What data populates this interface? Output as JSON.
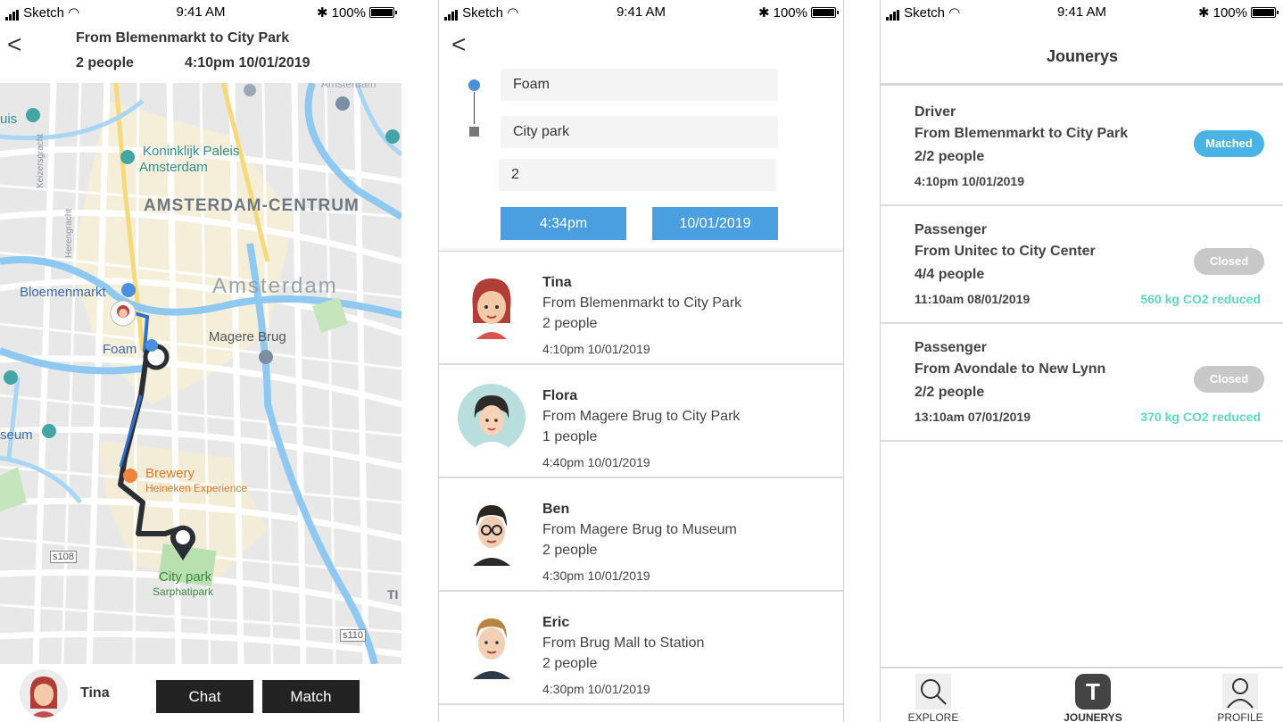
{
  "status": {
    "carrier": "Sketch",
    "time": "9:41 AM",
    "battery": "100%"
  },
  "screen1": {
    "back_label": "<",
    "title": "From Blemenmarkt to City Park",
    "people": "2 people",
    "datetime": "4:10pm 10/01/2019",
    "map_labels": {
      "koninklijk": "Koninklijk Paleis",
      "amsterdam_small": "Amsterdam",
      "centrum": "AMSTERDAM-CENTRUM",
      "amsterdam": "Amsterdam",
      "bloemenmarkt": "Bloemenmarkt",
      "foam": "Foam",
      "magere": "Magere Brug",
      "brewery": "Brewery",
      "heineken": "Heineken Experience",
      "citypark": "City park",
      "sarphati": "Sarphatipark",
      "museum": "seum",
      "uis": "uis",
      "s108": "s108",
      "s110": "s110",
      "amsterdam_top": "Amsterdam",
      "keizersgracht": "Keizersgracht",
      "herengracht": "Herengracht",
      "ti": "TI"
    },
    "bottom": {
      "name": "Tina",
      "chat": "Chat",
      "match": "Match"
    }
  },
  "screen2": {
    "back_label": "<",
    "from": "Foam",
    "to": "City park",
    "passengers": "2",
    "time_btn": "4:34pm",
    "date_btn": "10/01/2019",
    "rows": [
      {
        "name": "Tina",
        "route": "From Blemenmarkt to City Park",
        "people": "2 people",
        "time": "4:10pm 10/01/2019"
      },
      {
        "name": "Flora",
        "route": "From Magere Brug to City Park",
        "people": "1 people",
        "time": "4:40pm 10/01/2019"
      },
      {
        "name": "Ben",
        "route": "From Magere Brug to Museum",
        "people": "2 people",
        "time": "4:30pm 10/01/2019"
      },
      {
        "name": "Eric",
        "route": "From Brug Mall to Station",
        "people": "2 people",
        "time": "4:30pm 10/01/2019"
      }
    ]
  },
  "screen3": {
    "title": "Jounerys",
    "cards": [
      {
        "role": "Driver",
        "route": "From Blemenmarkt to City Park",
        "people": "2/2 people",
        "datetime": "4:10pm 10/01/2019",
        "status": "Matched",
        "status_color": "#4ab3e6",
        "co2": ""
      },
      {
        "role": "Passenger",
        "route": "From Unitec to City Center",
        "people": "4/4 people",
        "datetime": "11:10am 08/01/2019",
        "status": "Closed",
        "status_color": "#c8c8c8",
        "co2": "560 kg CO2 reduced"
      },
      {
        "role": "Passenger",
        "route": "From Avondale to New Lynn",
        "people": "2/2 people",
        "datetime": "13:10am 07/01/2019",
        "status": "Closed",
        "status_color": "#c8c8c8",
        "co2": "370 kg CO2 reduced"
      }
    ],
    "tabs": {
      "explore": "EXPLORE",
      "jounerys": "JOUNERYS",
      "jounerys_icon_letter": "T",
      "profile": "PROFILE"
    }
  },
  "colors": {
    "accent_blue": "#4a9fe0",
    "co2_green": "#5fd6c4",
    "route_dark": "#2a2f36",
    "route_blue": "#2f6fcf"
  }
}
